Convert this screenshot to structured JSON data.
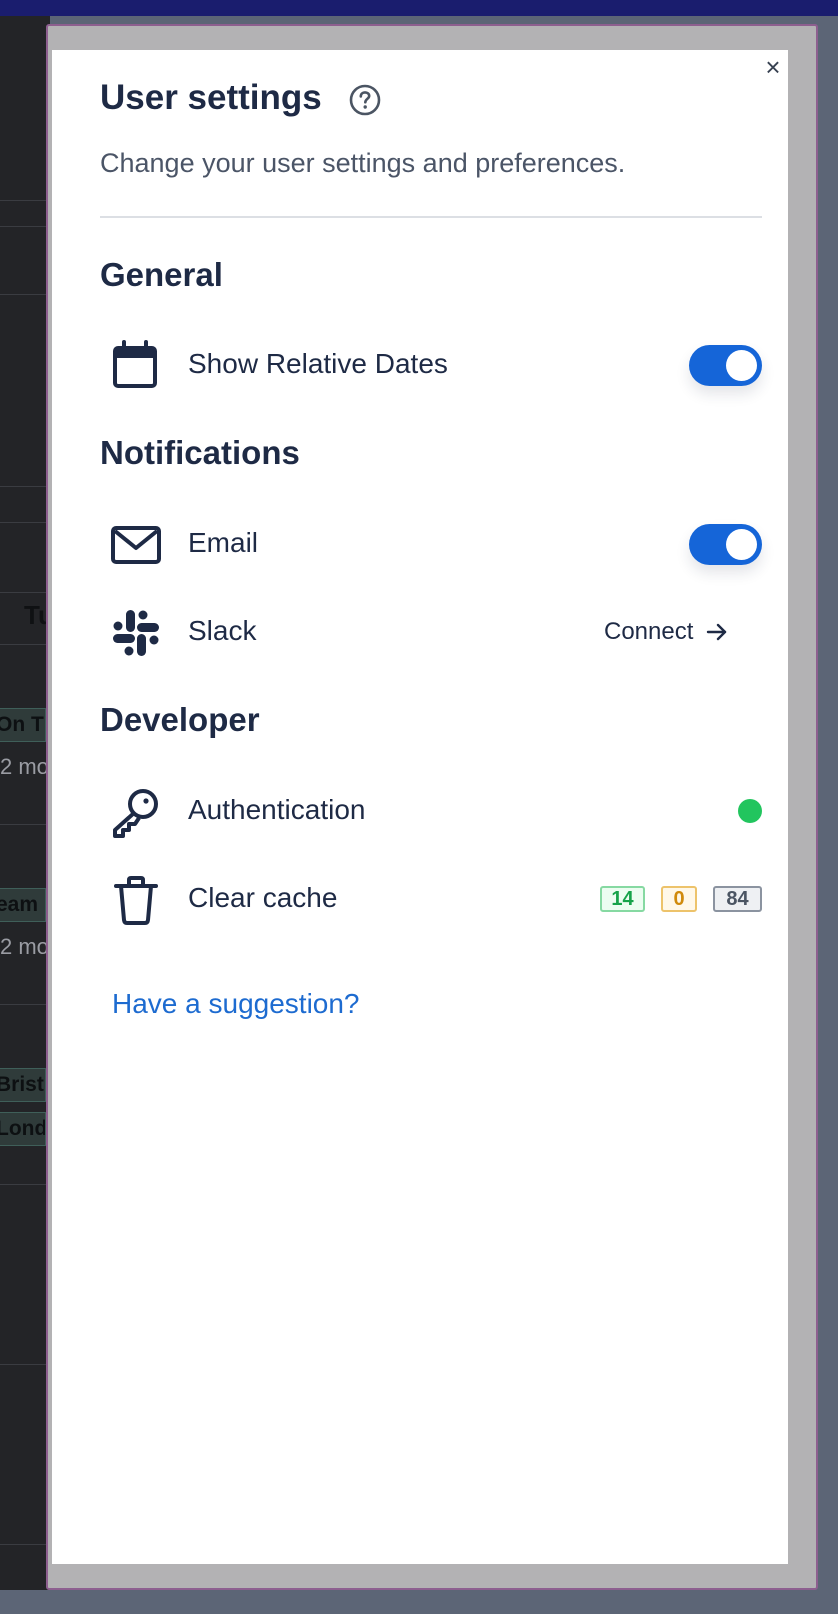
{
  "background": {
    "cells": [
      "On T",
      "2 mo",
      "eam",
      "2 mo",
      "Brist",
      "Lond"
    ],
    "column_header": "Tu"
  },
  "dialog": {
    "title": "User settings",
    "subtitle": "Change your user settings and preferences.",
    "close_label": "×",
    "sections": {
      "general": {
        "heading": "General",
        "relative_dates_label": "Show Relative Dates",
        "relative_dates_enabled": true
      },
      "notifications": {
        "heading": "Notifications",
        "email_label": "Email",
        "email_enabled": true,
        "slack_label": "Slack",
        "slack_action": "Connect"
      },
      "developer": {
        "heading": "Developer",
        "auth_label": "Authentication",
        "auth_status_color": "#22c55e",
        "cache_label": "Clear cache",
        "cache_counts": {
          "green": "14",
          "amber": "0",
          "gray": "84"
        }
      }
    },
    "suggestion_link": "Have a suggestion?"
  },
  "colors": {
    "accent": "#1565d8",
    "heading": "#1e2a45",
    "link": "#1d6bd0",
    "topbar": "#1a1d6e"
  },
  "icons": [
    "help-circle-icon",
    "calendar-icon",
    "envelope-icon",
    "slack-icon",
    "key-icon",
    "trash-icon",
    "arrow-right-icon",
    "close-icon"
  ]
}
